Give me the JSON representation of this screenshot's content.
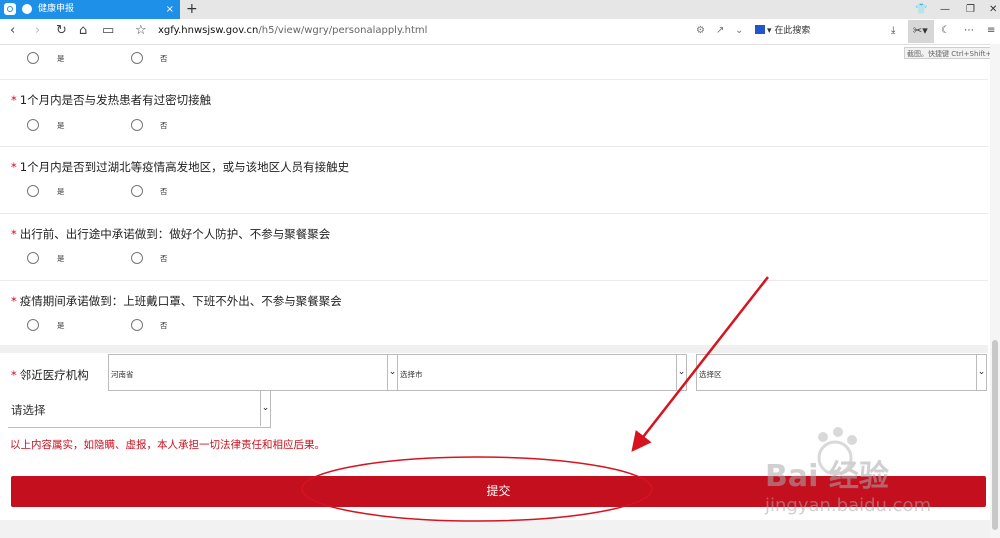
{
  "browser": {
    "tab_title": "健康申报",
    "tab_close": "×",
    "new_tab": "+",
    "url_domain": "xgfy.hnwsjsw.gov.cn",
    "url_path": "/h5/view/wgry/personalapply.html",
    "search_label": "在此搜索",
    "tooltip": "截图。快捷键 Ctrl+Shift+"
  },
  "questions": [
    {
      "title": "",
      "yes": "是",
      "no": "否"
    },
    {
      "title": "1个月内是否与发热患者有过密切接触",
      "yes": "是",
      "no": "否"
    },
    {
      "title": "1个月内是否到过湖北等疫情高发地区，或与该地区人员有接触史",
      "yes": "是",
      "no": "否"
    },
    {
      "title": "出行前、出行途中承诺做到：做好个人防护、不参与聚餐聚会",
      "yes": "是",
      "no": "否"
    },
    {
      "title": "疫情期间承诺做到：上班戴口罩、下班不外出、不参与聚餐聚会",
      "yes": "是",
      "no": "否"
    }
  ],
  "institution": {
    "label": "邻近医疗机构",
    "province": "河南省",
    "city": "选择市",
    "district": "选择区",
    "facility": "请选择"
  },
  "notice": "以上内容属实，如隐瞒、虚报，本人承担一切法律责任和相应后果。",
  "submit_label": "提交",
  "watermark": {
    "main": "Bai  经验",
    "url": "jingyan.baidu.com"
  },
  "colors": {
    "accent_red": "#c30f1e",
    "tab_blue": "#1e90e8",
    "annotation_red": "#d8131f"
  }
}
